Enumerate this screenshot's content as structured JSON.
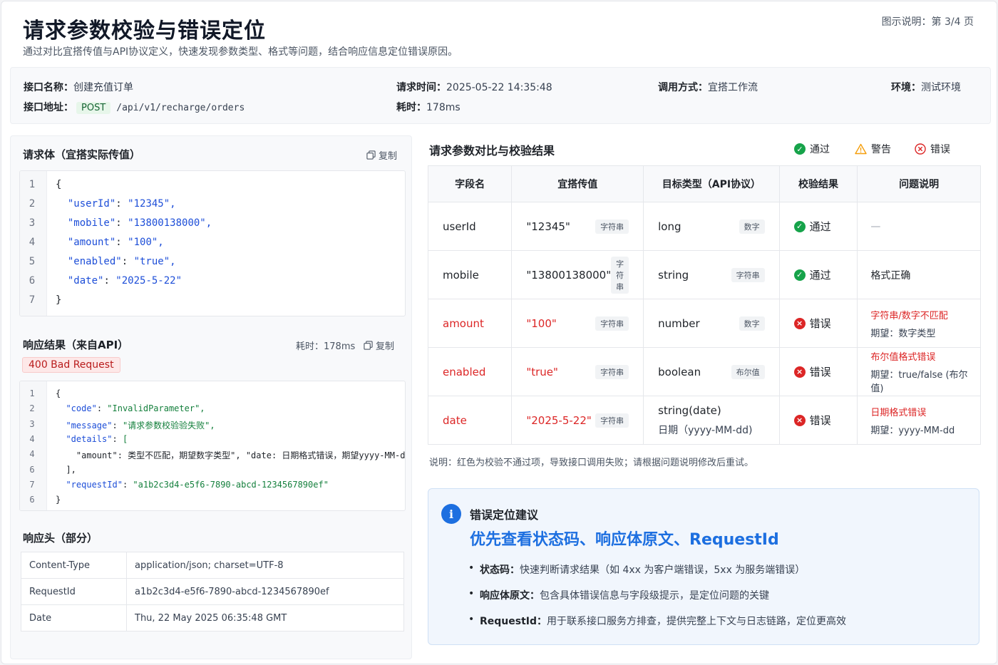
{
  "header": {
    "title": "请求参数校验与错误定位",
    "subtitle": "通过对比宜搭传值与API协议定义，快速发现参数类型、格式等问题，结合响应信息定位错误原因。",
    "page_hint": "图示说明：第 3/4 页"
  },
  "meta": {
    "api_name_label": "接口名称：",
    "api_name": "创建充值订单",
    "api_addr_label": "接口地址：",
    "method": "POST",
    "path": "/api/v1/recharge/orders",
    "req_time_label": "请求时间：",
    "req_time": "2025-05-22 14:35:48",
    "duration_label": "耗时：",
    "duration": "178ms",
    "call_mode_label": "调用方式：",
    "call_mode": "宜搭工作流",
    "env_label": "环境：",
    "env": "测试环境"
  },
  "request_body": {
    "title": "请求体（宜搭实际传值）",
    "copy_label": "复制",
    "lines": [
      {
        "n": "1",
        "text": "{"
      },
      {
        "n": "2",
        "key": "\"userId\"",
        "val": "\"12345\","
      },
      {
        "n": "3",
        "key": "\"mobile\"",
        "val": "\"13800138000\","
      },
      {
        "n": "4",
        "key": "\"amount\"",
        "val": "\"100\","
      },
      {
        "n": "5",
        "key": "\"enabled\"",
        "val": "\"true\","
      },
      {
        "n": "6",
        "key": "\"date\"",
        "val": "\"2025-5-22\""
      },
      {
        "n": "7",
        "text": "}"
      }
    ]
  },
  "response": {
    "title": "响应结果（来自API）",
    "duration_text": "耗时：178ms",
    "copy_label": "复制",
    "status": "400 Bad Request",
    "lines": [
      {
        "n": "1",
        "text": "{"
      },
      {
        "n": "2",
        "key": "\"code\"",
        "val": "\"InvalidParameter\","
      },
      {
        "n": "3",
        "key": "\"message\"",
        "val": "\"请求参数校验验失败\","
      },
      {
        "n": "4",
        "key": "\"details\"",
        "val": "["
      },
      {
        "n": "4",
        "text": "    \"amount\": 类型不匹配，期望数字类型\", \"date: 日期格式错误，期望yyyy-MM-dd\""
      },
      {
        "n": "6",
        "text": "  ],"
      },
      {
        "n": "7",
        "key": "\"requestId\"",
        "val": "\"a1b2c3d4-e5f6-7890-abcd-1234567890ef\""
      },
      {
        "n": "6",
        "text": "}"
      }
    ]
  },
  "response_headers": {
    "title": "响应头（部分）",
    "rows": [
      {
        "k": "Content-Type",
        "v": "application/json; charset=UTF-8"
      },
      {
        "k": "RequestId",
        "v": "a1b2c3d4-e5f6-7890-abcd-1234567890ef"
      },
      {
        "k": "Date",
        "v": "Thu, 22 May 2025 06:35:48 GMT"
      }
    ]
  },
  "compare": {
    "title": "请求参数对比与校验结果",
    "legend": {
      "pass": "通过",
      "warn": "警告",
      "error": "错误"
    },
    "columns": [
      "字段名",
      "宜搭传值",
      "目标类型（API协议）",
      "校验结果",
      "问题说明"
    ],
    "rows": [
      {
        "field": "userId",
        "value": "\"12345\"",
        "value_tag": "字符串",
        "type": "long",
        "type_sub": "",
        "type_tag": "数字",
        "result": "通过",
        "status": "pass",
        "issue": "—",
        "issue_sub": ""
      },
      {
        "field": "mobile",
        "value": "\"13800138000\"",
        "value_tag": "字符串",
        "type": "string",
        "type_sub": "",
        "type_tag": "字符串",
        "result": "通过",
        "status": "pass",
        "issue": "格式正确",
        "issue_sub": ""
      },
      {
        "field": "amount",
        "value": "\"100\"",
        "value_tag": "字符串",
        "type": "number",
        "type_sub": "",
        "type_tag": "数字",
        "result": "错误",
        "status": "error",
        "issue": "字符串/数字不匹配",
        "issue_sub": "期望：数字类型"
      },
      {
        "field": "enabled",
        "value": "\"true\"",
        "value_tag": "字符串",
        "type": "boolean",
        "type_sub": "",
        "type_tag": "布尔值",
        "result": "错误",
        "status": "error",
        "issue": "布尔值格式错误",
        "issue_sub": "期望：true/false (布尔值)"
      },
      {
        "field": "date",
        "value": "\"2025-5-22\"",
        "value_tag": "字符串",
        "type": "string(date)",
        "type_sub": "日期（yyyy-MM-dd)",
        "type_tag": "",
        "result": "错误",
        "status": "error",
        "issue": "日期格式错误",
        "issue_sub": "期望：yyyy-MM-dd"
      }
    ],
    "note": "说明：红色为校验不通过项，导致接口调用失败；请根据问题说明修改后重试。"
  },
  "advice": {
    "title": "错误定位建议",
    "headline": "优先查看状态码、响应体原文、RequestId",
    "items": [
      {
        "bold": "状态码：",
        "text": "快速判断请求结果（如 4xx 为客户端错误，5xx 为服务端错误）"
      },
      {
        "bold": "响应体原文：",
        "text": "包含具体错误信息与字段级提示，是定位问题的关键"
      },
      {
        "bold": "RequestId：",
        "text": "用于联系接口服务方排查，提供完整上下文与日志链路，定位更高效"
      }
    ]
  },
  "colors": {
    "accent": "#1d6fe0",
    "error": "#dc2626",
    "success": "#16a34a",
    "warning": "#f59e0b"
  }
}
